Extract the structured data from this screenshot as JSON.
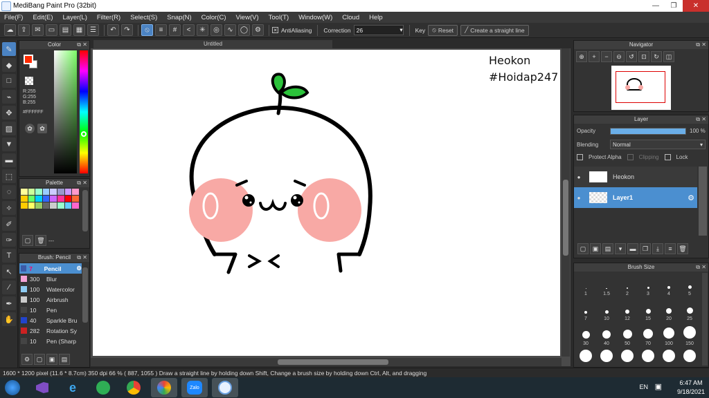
{
  "window": {
    "title": "MediBang Paint Pro (32bit)"
  },
  "menu": [
    "File(F)",
    "Edit(E)",
    "Layer(L)",
    "Filter(R)",
    "Select(S)",
    "Snap(N)",
    "Color(C)",
    "View(V)",
    "Tool(T)",
    "Window(W)",
    "Cloud",
    "Help"
  ],
  "toolbar": {
    "antialiasing_label": "AntiAliasing",
    "correction_label": "Correction",
    "correction_value": "26",
    "key_label": "Key",
    "reset_label": "Reset",
    "straight_line_label": "Create a straight line"
  },
  "color_panel": {
    "title": "Color",
    "r": "R:255",
    "g": "G:255",
    "b": "B:255",
    "hex": "#FFFFFF",
    "foreground": "#ff2a00",
    "background": "#ffffff"
  },
  "palette_panel": {
    "title": "Palette",
    "colors": [
      "#ffff99",
      "#ccff99",
      "#99ffcc",
      "#99ccff",
      "#ccccff",
      "#9999cc",
      "#cc99ff",
      "#ff99cc",
      "#ffcc00",
      "#66ff66",
      "#00ccff",
      "#3366ff",
      "#cc66ff",
      "#ff3399",
      "#ff0000",
      "#ff6633",
      "#ffcc00",
      "#ffff66",
      "#99cc66",
      "#666666",
      "#cccccc",
      "#99ffcc",
      "#66ccff",
      "#ff66cc"
    ],
    "separator": "---"
  },
  "brush_panel": {
    "title": "Brush: Pencil",
    "brushes": [
      {
        "size": "7",
        "name": "Pencil",
        "swatch": "#3b5aa8",
        "selected": true
      },
      {
        "size": "300",
        "name": "Blur",
        "swatch": "#f3a2d6",
        "selected": false
      },
      {
        "size": "100",
        "name": "Watercolor",
        "swatch": "#8ecbf2",
        "selected": false
      },
      {
        "size": "100",
        "name": "Airbrush",
        "swatch": "#cccccc",
        "selected": false
      },
      {
        "size": "10",
        "name": "Pen",
        "swatch": "#444444",
        "selected": false
      },
      {
        "size": "40",
        "name": "Sparkle Bru",
        "swatch": "#2244cc",
        "selected": false
      },
      {
        "size": "282",
        "name": "Rotation Sy",
        "swatch": "#cc2222",
        "selected": false
      },
      {
        "size": "10",
        "name": "Pen (Sharp",
        "swatch": "#444444",
        "selected": false
      }
    ]
  },
  "canvas": {
    "tab_title": "Untitled",
    "text_line1": "Heokon",
    "text_line2": "#Hoidap247"
  },
  "navigator": {
    "title": "Navigator"
  },
  "layer_panel": {
    "title": "Layer",
    "opacity_label": "Opacity",
    "opacity_value": "100 %",
    "opacity_fraction": 1.0,
    "blending_label": "Blending",
    "blending_value": "Normal",
    "protect_alpha": "Protect Alpha",
    "clipping": "Clipping",
    "lock": "Lock",
    "layers": [
      {
        "name": "Heokon",
        "selected": false
      },
      {
        "name": "Layer1",
        "selected": true
      }
    ]
  },
  "brush_size_panel": {
    "title": "Brush Size",
    "sizes": [
      "1",
      "1.5",
      "2",
      "3",
      "4",
      "5",
      "7",
      "10",
      "12",
      "15",
      "20",
      "25",
      "30",
      "40",
      "50",
      "70",
      "100",
      "150"
    ]
  },
  "status": {
    "text": "1600 * 1200 pixel  (11.6 * 8.7cm)  350 dpi  66 %  ( 887, 1055 )  Draw a straight line by holding down Shift, Change a brush size by holding down Ctrl, Alt, and dragging"
  },
  "taskbar": {
    "language": "EN",
    "time": "6:47 AM",
    "date": "9/18/2021"
  }
}
